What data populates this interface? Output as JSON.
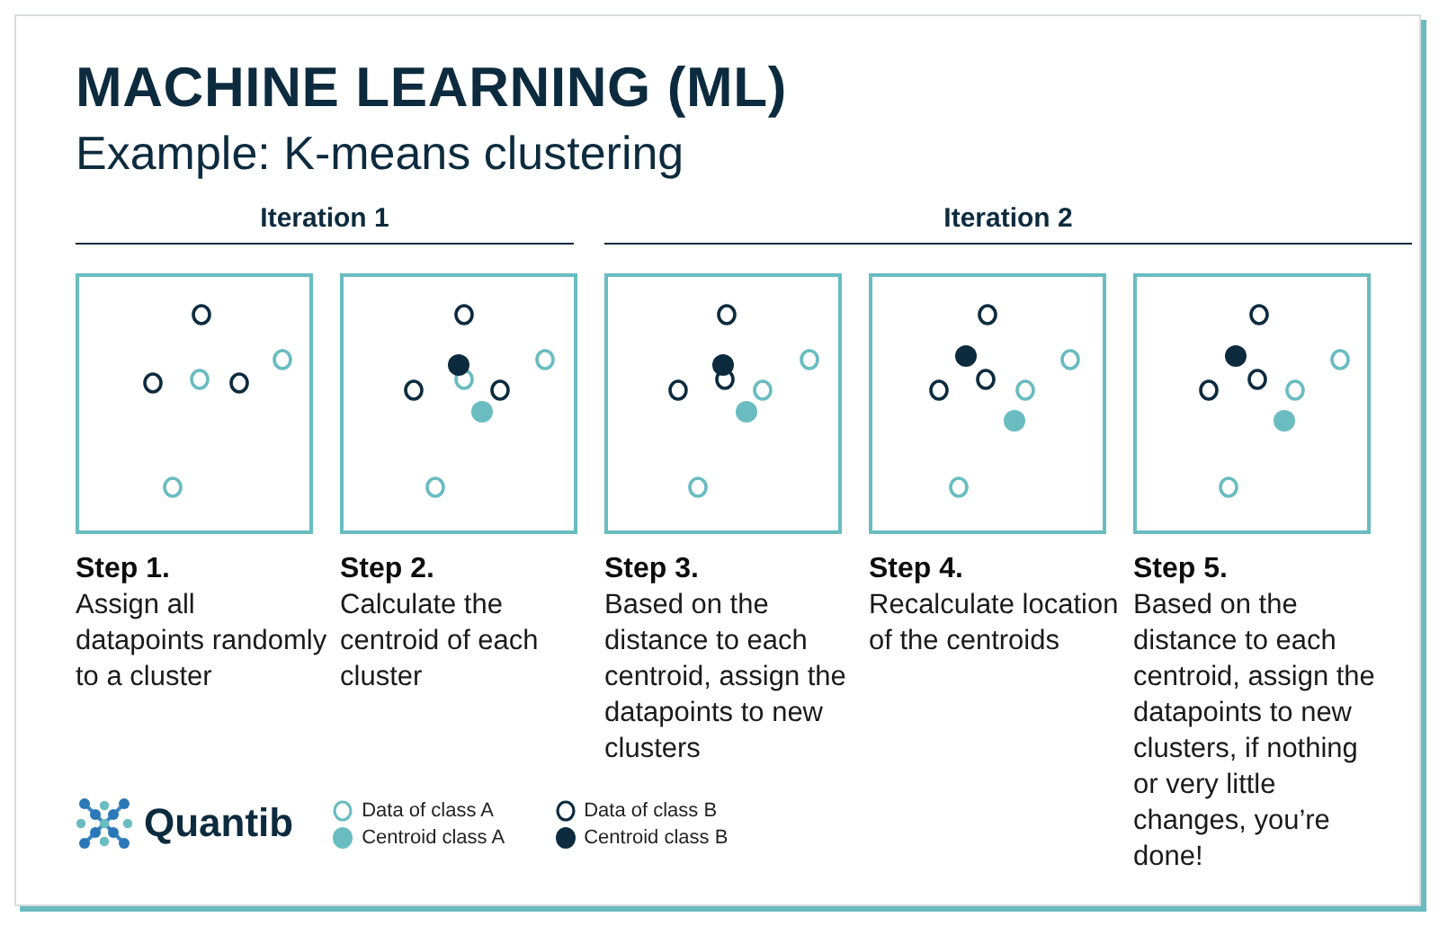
{
  "title": "MACHINE LEARNING (ML)",
  "subtitle": "Example: K-means clustering",
  "iterations": [
    {
      "label": "Iteration 1",
      "steps": [
        {
          "label": "Step 1.",
          "text": "Assign all datapoints randomly to a cluster"
        },
        {
          "label": "Step 2.",
          "text": "Calculate the centroid of each cluster"
        }
      ]
    },
    {
      "label": "Iteration 2",
      "steps": [
        {
          "label": "Step 3.",
          "text": "Based on the distance to each centroid, assign the datapoints to new clusters"
        },
        {
          "label": "Step 4.",
          "text": "Recalculate location of the centroids"
        },
        {
          "label": "Step 5.",
          "text": "Based on the distance to each centroid, assign the datapoints to new clusters, if nothing or very little changes, you’re done!"
        }
      ]
    }
  ],
  "logo": {
    "name": "Quantib"
  },
  "legend": [
    {
      "kind": "data",
      "color": "#69bcc0",
      "label": "Data of class A"
    },
    {
      "kind": "data",
      "color": "#0d2b3e",
      "label": "Data of class B"
    },
    {
      "kind": "centroid",
      "color": "#69bcc0",
      "label": "Centroid class A"
    },
    {
      "kind": "centroid",
      "color": "#0d2b3e",
      "label": "Centroid class B"
    }
  ]
}
